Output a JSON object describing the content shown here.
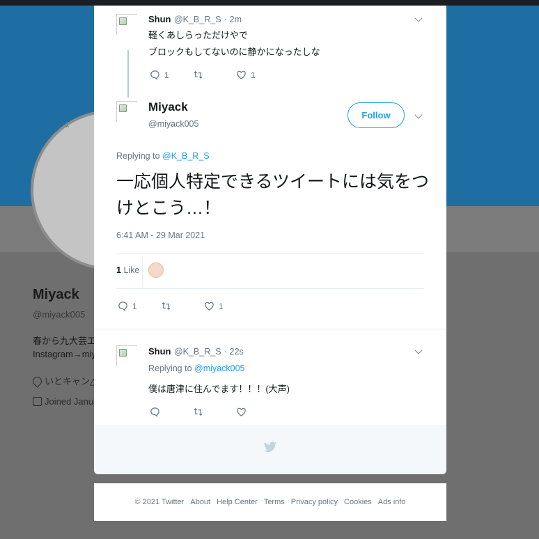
{
  "background_profile": {
    "name": "Miyack",
    "handle": "@miyack005",
    "bio_line1": "春から九大芸工ID",
    "bio_line2": "Instagram→miya",
    "location": "いとキャン△",
    "joined": "Joined Januar"
  },
  "tweet_parent": {
    "name": "Shun",
    "handle": "@K_B_R_S",
    "time": "· 2m",
    "line1": "軽くあしらっただけやで",
    "line2": "ブロックもしてないのに静かになったしな",
    "reply_count": "1",
    "retweet_count": "",
    "like_count": "1"
  },
  "main_tweet": {
    "name": "Miyack",
    "handle": "@miyack005",
    "follow_label": "Follow",
    "replying_prefix": "Replying to",
    "replying_to": "@K_B_R_S",
    "text": "一応個人特定できるツイートには気をつけとこう…！",
    "timestamp": "6:41 AM - 29 Mar 2021",
    "likes_count": "1",
    "likes_label": "Like",
    "reply_count": "1",
    "retweet_count": "",
    "like_count": "1"
  },
  "tweet_reply": {
    "name": "Shun",
    "handle": "@K_B_R_S",
    "time": "· 22s",
    "replying_prefix": "Replying to",
    "replying_to": "@miyack005",
    "text": "僕は唐津に住んでます！！！(大声)",
    "reply_count": "",
    "retweet_count": "",
    "like_count": ""
  },
  "footer": {
    "copyright": "© 2021 Twitter",
    "about": "About",
    "help": "Help Center",
    "terms": "Terms",
    "privacy": "Privacy policy",
    "cookies": "Cookies",
    "ads": "Ads info"
  },
  "colors": {
    "accent": "#1da1f2",
    "banner": "#1f6ea3"
  }
}
